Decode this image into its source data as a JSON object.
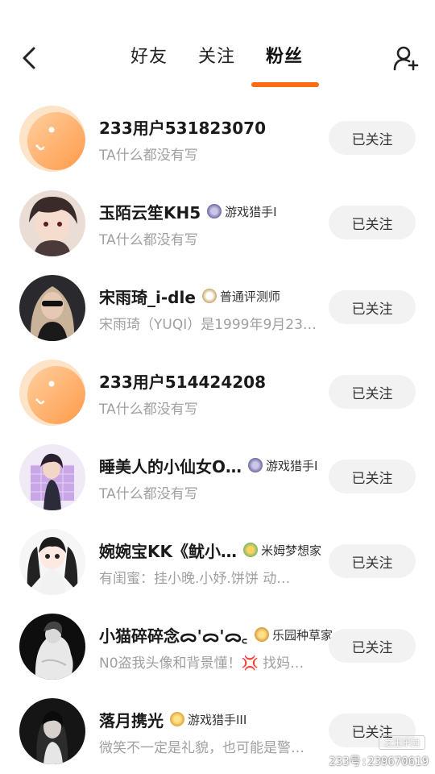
{
  "header": {
    "tabs": [
      {
        "label": "好友"
      },
      {
        "label": "关注"
      },
      {
        "label": "粉丝"
      }
    ],
    "active_tab": "粉丝",
    "accent_color": "#ff6a13"
  },
  "users": [
    {
      "name": "233用户531823070",
      "badge": "",
      "bio": "TA什么都没有写",
      "button": "已关注",
      "avatar": "default-233-avatar"
    },
    {
      "name": "玉陌云笙KH5",
      "badge": "游戏猎手I",
      "bio": "TA什么都没有写",
      "button": "已关注",
      "avatar": "anime-boy-avatar"
    },
    {
      "name": "宋雨琦_i-dle",
      "badge": "普通评测师",
      "bio": "宋雨琦（YUQI）是1999年9月23…",
      "button": "已关注",
      "avatar": "photo-girl-avatar"
    },
    {
      "name": "233用户514424208",
      "badge": "",
      "bio": "TA什么都没有写",
      "button": "已关注",
      "avatar": "default-233-avatar"
    },
    {
      "name": "睡美人的小仙女O…",
      "badge": "游戏猎手I",
      "bio": "TA什么都没有写",
      "button": "已关注",
      "avatar": "anime-girl-purple-avatar"
    },
    {
      "name": "婉婉宝KK《鱿小…",
      "badge": "米姆梦想家",
      "bio": "有闺蜜：挂小晚.小妤.饼饼 动…",
      "button": "已关注",
      "avatar": "doll-girl-avatar"
    },
    {
      "name": "小猫碎碎念ᯅ'ᯅ'ᯅ꜀ᶻᶻᶻ",
      "badge": "乐园种草家",
      "bio": "N0盗我头像和背景懂！💢 找妈…",
      "button": "已关注",
      "avatar": "white-dress-avatar"
    },
    {
      "name": "落月携光",
      "badge": "游戏猎手III",
      "bio": "微笑不一定是礼貌，也可能是警…",
      "button": "已关注",
      "avatar": "dark-girl-avatar"
    }
  ],
  "watermark": {
    "text": "233号:239670619",
    "logo_text": "之王乐园"
  }
}
